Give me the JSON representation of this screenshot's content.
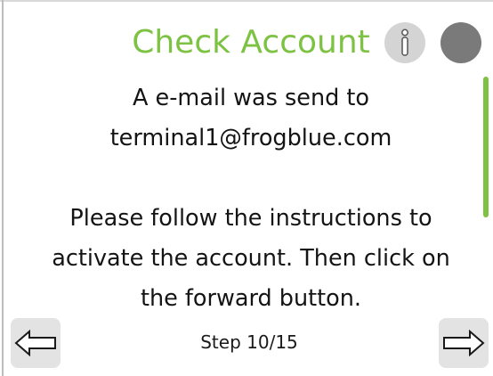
{
  "header": {
    "title": "Check Account",
    "info_icon": "info-icon",
    "status_icon": "status-dot"
  },
  "message": {
    "line1": "A e-mail was send to",
    "line2": "terminal1@frogblue.com",
    "line3": "Please follow the instructions to",
    "line4": "activate the account. Then click on",
    "line5": "the forward button."
  },
  "footer": {
    "step_label": "Step 10/15",
    "back_icon": "arrow-left-icon",
    "forward_icon": "arrow-right-icon"
  },
  "colors": {
    "accent": "#7dc242",
    "status": "#7a7a7a",
    "button_bg": "#e3e3e3"
  }
}
